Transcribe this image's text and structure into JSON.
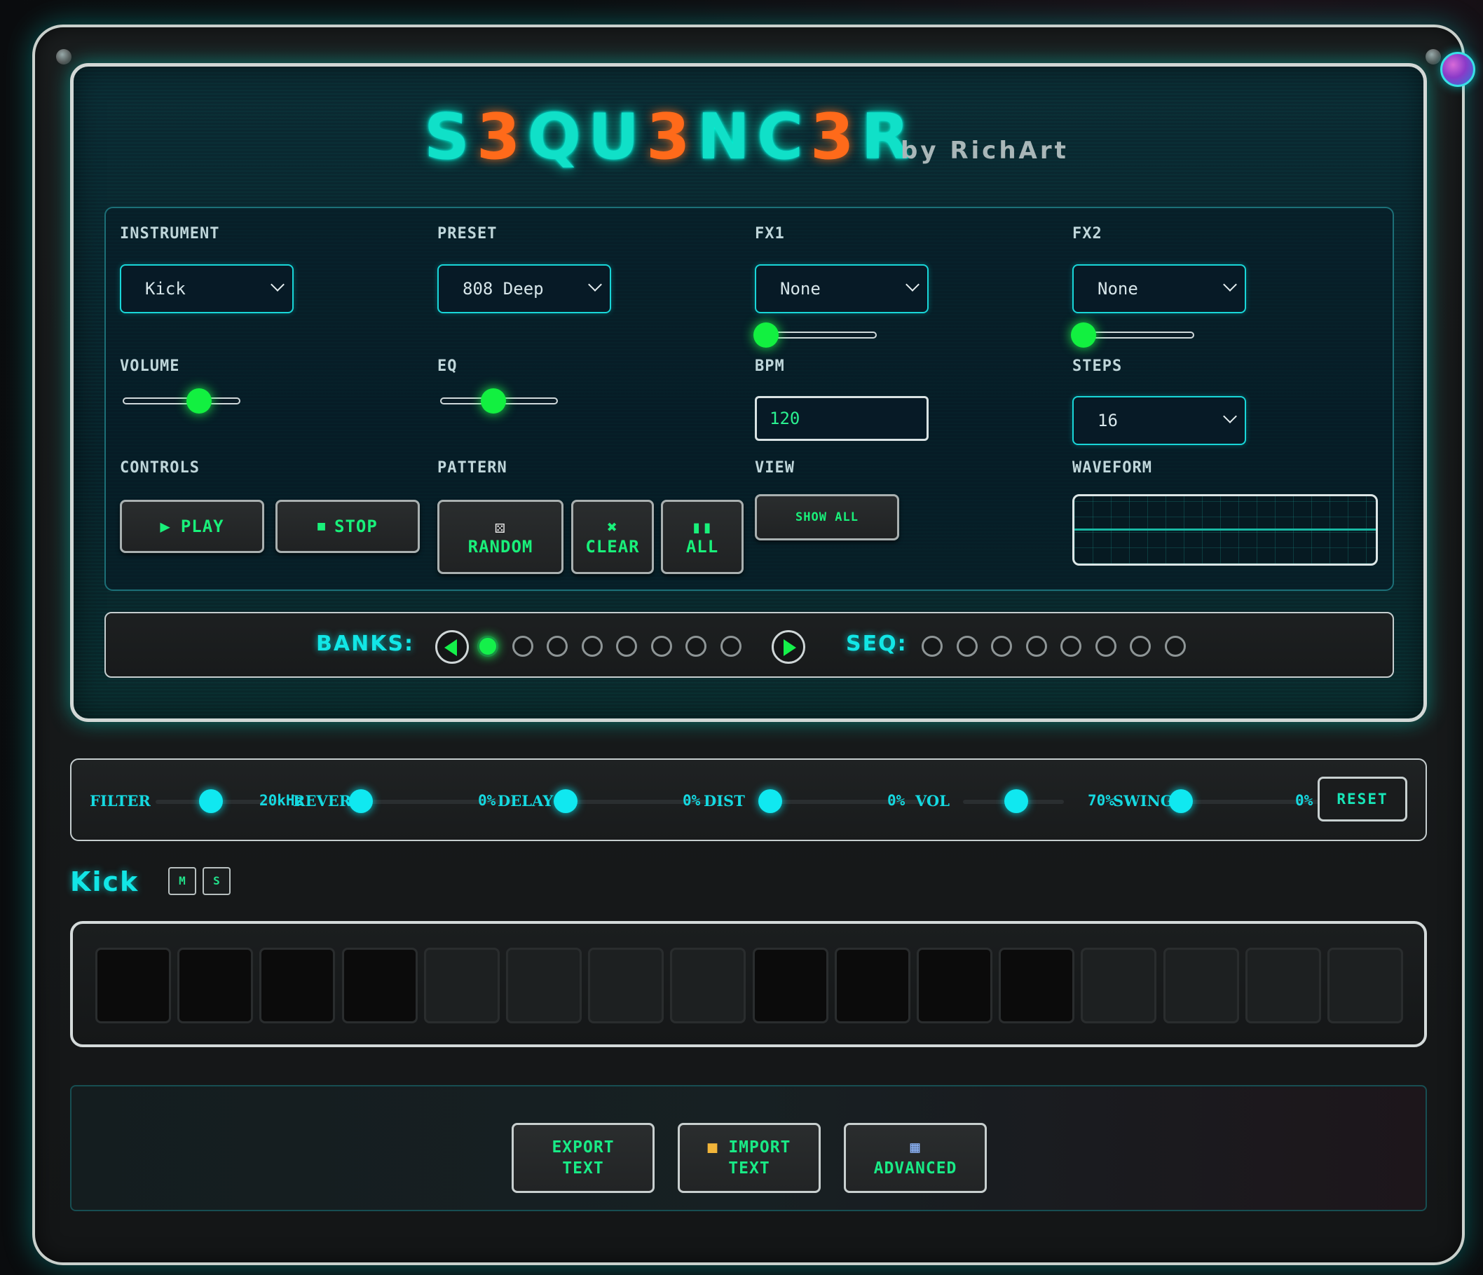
{
  "app": {
    "title_parts": [
      {
        "t": "S",
        "c": "cyan"
      },
      {
        "t": "3",
        "c": "orange"
      },
      {
        "t": "QU",
        "c": "cyan"
      },
      {
        "t": "3",
        "c": "orange"
      },
      {
        "t": "NC",
        "c": "cyan"
      },
      {
        "t": "3",
        "c": "orange"
      },
      {
        "t": "R",
        "c": "cyan"
      }
    ],
    "byline": "by RichArt"
  },
  "controls": {
    "instrument": {
      "label": "INSTRUMENT",
      "value": "Kick"
    },
    "preset": {
      "label": "PRESET",
      "value": "808 Deep"
    },
    "fx1": {
      "label": "FX1",
      "value": "None",
      "level": 0.0
    },
    "fx2": {
      "label": "FX2",
      "value": "None",
      "level": 0.0
    },
    "volume": {
      "label": "VOLUME",
      "level": 0.75
    },
    "eq": {
      "label": "EQ",
      "level": 0.5
    },
    "bpm": {
      "label": "BPM",
      "value": "120"
    },
    "steps": {
      "label": "STEPS",
      "value": "16"
    },
    "controls_label": "CONTROLS",
    "play": "PLAY",
    "stop": "STOP",
    "pattern_label": "PATTERN",
    "random": "RANDOM",
    "clear": "CLEAR",
    "all": "ALL",
    "view_label": "VIEW",
    "show_all": "SHOW ALL",
    "waveform_label": "WAVEFORM"
  },
  "banks": {
    "label": "BANKS:",
    "count": 8,
    "active": 0,
    "seq_label": "SEQ:",
    "seq_count": 8
  },
  "effects": {
    "filter": {
      "label": "FILTER",
      "value": "20kHz",
      "level": 1.0
    },
    "reverb": {
      "label": "REVERB",
      "value": "0%",
      "level": 0.0
    },
    "delay": {
      "label": "DELAY",
      "value": "0%",
      "level": 0.0
    },
    "dist": {
      "label": "DIST",
      "value": "0%",
      "level": 0.0
    },
    "vol": {
      "label": "VOL",
      "value": "70%",
      "level": 0.7
    },
    "swing": {
      "label": "SWING",
      "value": "0%",
      "level": 0.0
    },
    "reset": "RESET"
  },
  "track": {
    "name": "Kick",
    "mute": "M",
    "solo": "S",
    "steps": [
      "dark",
      "dark",
      "dark",
      "dark",
      "light",
      "light",
      "light",
      "light",
      "dark",
      "dark",
      "dark",
      "dark",
      "light",
      "light",
      "light",
      "light"
    ]
  },
  "footer": {
    "export_l1": "EXPORT",
    "export_l2": "TEXT",
    "import_l1": "IMPORT",
    "import_l2": "TEXT",
    "advanced": "ADVANCED"
  },
  "icons": {
    "play": "play-icon",
    "stop": "stop-icon",
    "random": "dice-icon",
    "clear": "x-icon",
    "all": "drums-icon",
    "import": "folder-icon",
    "advanced": "grid-icon"
  }
}
